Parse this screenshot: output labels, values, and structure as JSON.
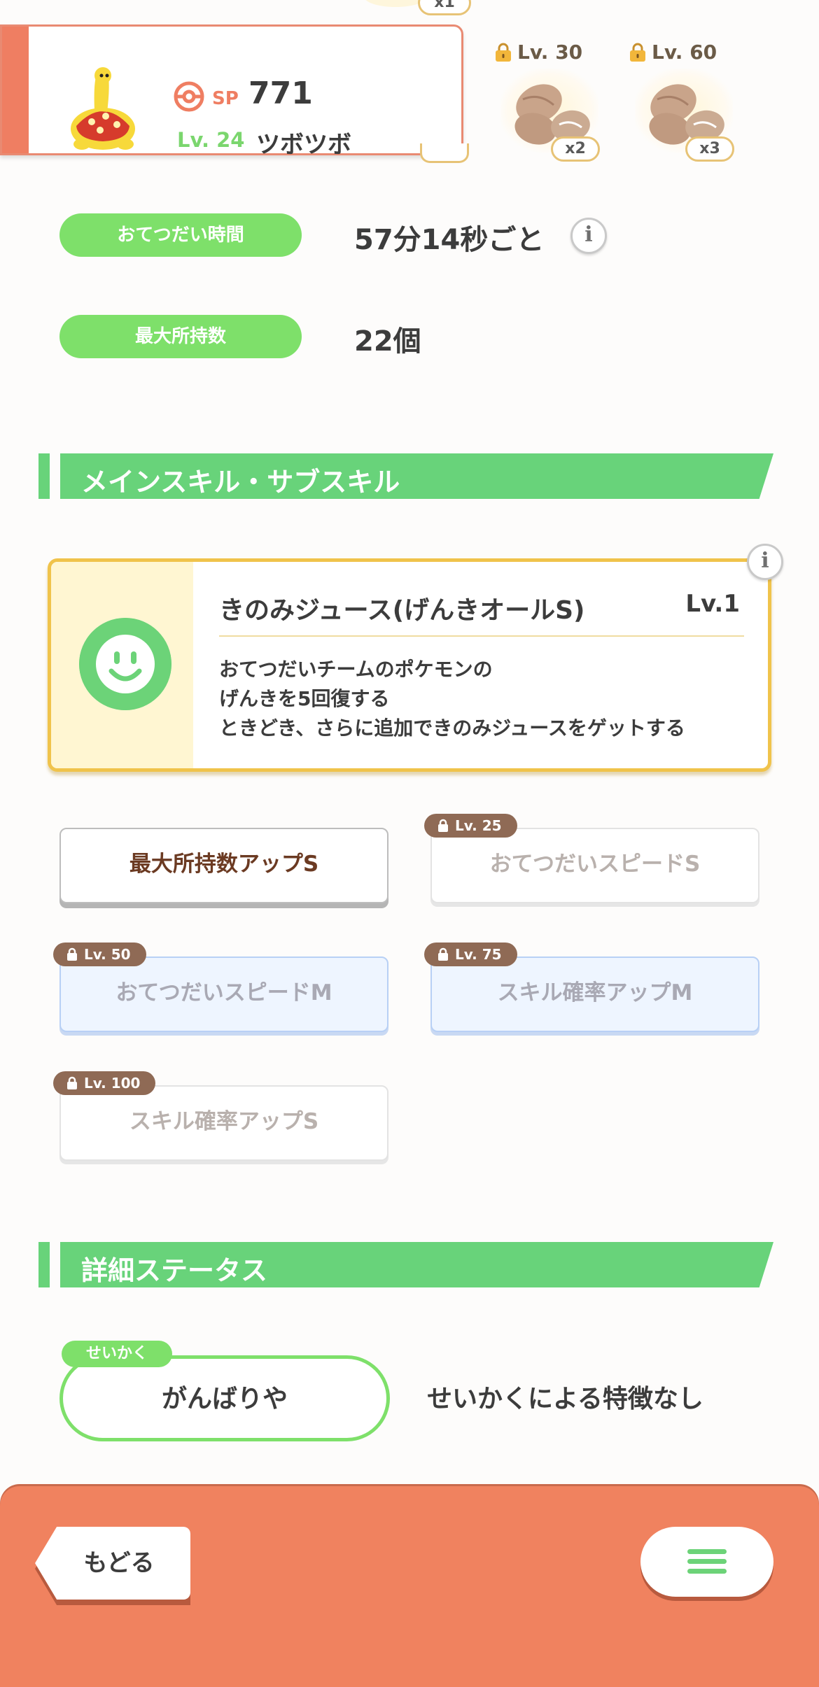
{
  "header": {
    "top_badge": "x1",
    "sp_label": "SP",
    "sp_value": "771",
    "level_label": "Lv. 24",
    "pokemon_name": "ツボツボ",
    "ingredient_slots": [
      {
        "level": "Lv. 30",
        "qty": "x2"
      },
      {
        "level": "Lv. 60",
        "qty": "x3"
      }
    ]
  },
  "stats": {
    "help_time_label": "おてつだい時間",
    "help_time_value": "57分14秒ごと",
    "max_carry_label": "最大所持数",
    "max_carry_value": "22個"
  },
  "skills_section": {
    "title": "メインスキル・サブスキル",
    "main_skill": {
      "name": "きのみジュース(げんきオールS)",
      "level": "Lv.1",
      "description": [
        "おてつだいチームのポケモンの",
        "げんきを5回復する",
        "ときどき、さらに追加できのみジュースをゲットする"
      ]
    },
    "sub_skills": [
      {
        "label": "最大所持数アップS",
        "lock": ""
      },
      {
        "label": "おてつだいスピードS",
        "lock": "Lv. 25"
      },
      {
        "label": "おてつだいスピードM",
        "lock": "Lv. 50"
      },
      {
        "label": "スキル確率アップM",
        "lock": "Lv. 75"
      },
      {
        "label": "スキル確率アップS",
        "lock": "Lv. 100"
      }
    ]
  },
  "detail_section": {
    "title": "詳細ステータス",
    "nature_tag": "せいかく",
    "nature_value": "がんばりや",
    "nature_desc": "せいかくによる特徴なし"
  },
  "footer": {
    "back_label": "もどる"
  },
  "colors": {
    "accent_green": "#7ee06a",
    "section_green": "#68d37a",
    "footer_orange": "#f0825f",
    "skill_gold": "#f0c34b"
  }
}
